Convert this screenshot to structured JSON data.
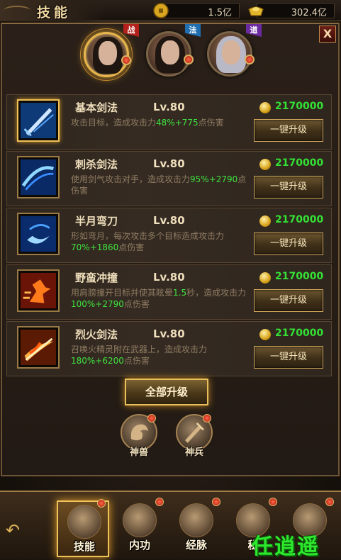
{
  "header": {
    "title": "技能",
    "gold": {
      "icon": "gold-coin-icon",
      "value": "1.5亿"
    },
    "ingot": {
      "icon": "gold-ingot-icon",
      "value": "302.4亿"
    },
    "close_label": "X"
  },
  "heroes": [
    {
      "name": "hero-warrior",
      "tag": "战",
      "tag_color": "#b3201c",
      "active": true
    },
    {
      "name": "hero-mage",
      "tag": "法",
      "tag_color": "#1f6fb0",
      "active": false
    },
    {
      "name": "hero-taoist",
      "tag": "道",
      "tag_color": "#6a2aa0",
      "active": false
    }
  ],
  "skills": [
    {
      "name": "基本剑法",
      "level": "Lv.80",
      "cost": "2170000",
      "button": "一键升级",
      "desc_parts": [
        {
          "text": "攻击目标，造成攻击力",
          "hl": false
        },
        {
          "text": "48%+775",
          "hl": true
        },
        {
          "text": "点伤害",
          "hl": false
        }
      ],
      "icon": "basic-sword-icon"
    },
    {
      "name": "刺杀剑法",
      "level": "Lv.80",
      "cost": "2170000",
      "button": "一键升级",
      "desc_parts": [
        {
          "text": "使用剑气攻击对手，造成攻击力",
          "hl": false
        },
        {
          "text": "95%+2790",
          "hl": true
        },
        {
          "text": "点伤害",
          "hl": false
        }
      ],
      "icon": "assassinate-sword-icon"
    },
    {
      "name": "半月弯刀",
      "level": "Lv.80",
      "cost": "2170000",
      "button": "一键升级",
      "desc_parts": [
        {
          "text": "形如弯月，每次攻击多个目标造成攻击力",
          "hl": false
        },
        {
          "text": "70%+1860",
          "hl": true
        },
        {
          "text": "点伤害",
          "hl": false
        }
      ],
      "icon": "half-moon-blade-icon"
    },
    {
      "name": "野蛮冲撞",
      "level": "Lv.80",
      "cost": "2170000",
      "button": "一键升级",
      "desc_parts": [
        {
          "text": "用肩膀撞开目标并使其眩晕",
          "hl": false
        },
        {
          "text": "1.5",
          "hl": true
        },
        {
          "text": "秒，造成攻击力",
          "hl": false
        },
        {
          "text": "100%+2790",
          "hl": true
        },
        {
          "text": "点伤害",
          "hl": false
        }
      ],
      "icon": "savage-charge-icon"
    },
    {
      "name": "烈火剑法",
      "level": "Lv.80",
      "cost": "2170000",
      "button": "一键升级",
      "desc_parts": [
        {
          "text": "召唤火精灵附在武器上，造成攻击力",
          "hl": false
        },
        {
          "text": "180%+6200",
          "hl": true
        },
        {
          "text": "点伤害",
          "hl": false
        }
      ],
      "icon": "blazing-sword-icon"
    }
  ],
  "upgrade_all": "全部升级",
  "mini_buttons": [
    {
      "label": "神兽",
      "icon": "divine-beast-icon"
    },
    {
      "label": "神兵",
      "icon": "divine-weapon-icon"
    }
  ],
  "nav": {
    "back_icon": "back-arrow-icon",
    "tabs": [
      {
        "label": "技能",
        "icon": "skill-scroll-icon",
        "active": true
      },
      {
        "label": "内功",
        "icon": "inner-power-icon",
        "active": false
      },
      {
        "label": "经脉",
        "icon": "meridian-icon",
        "active": false
      },
      {
        "label": "秘",
        "icon": "secret-book-icon",
        "active": false
      },
      {
        "label": "",
        "icon": "crown-icon",
        "active": false
      }
    ]
  },
  "watermark": "任逍遥",
  "colors": {
    "highlight": "#3fe33f",
    "cost": "#34e035",
    "gold_border": "#e9bf5c"
  }
}
